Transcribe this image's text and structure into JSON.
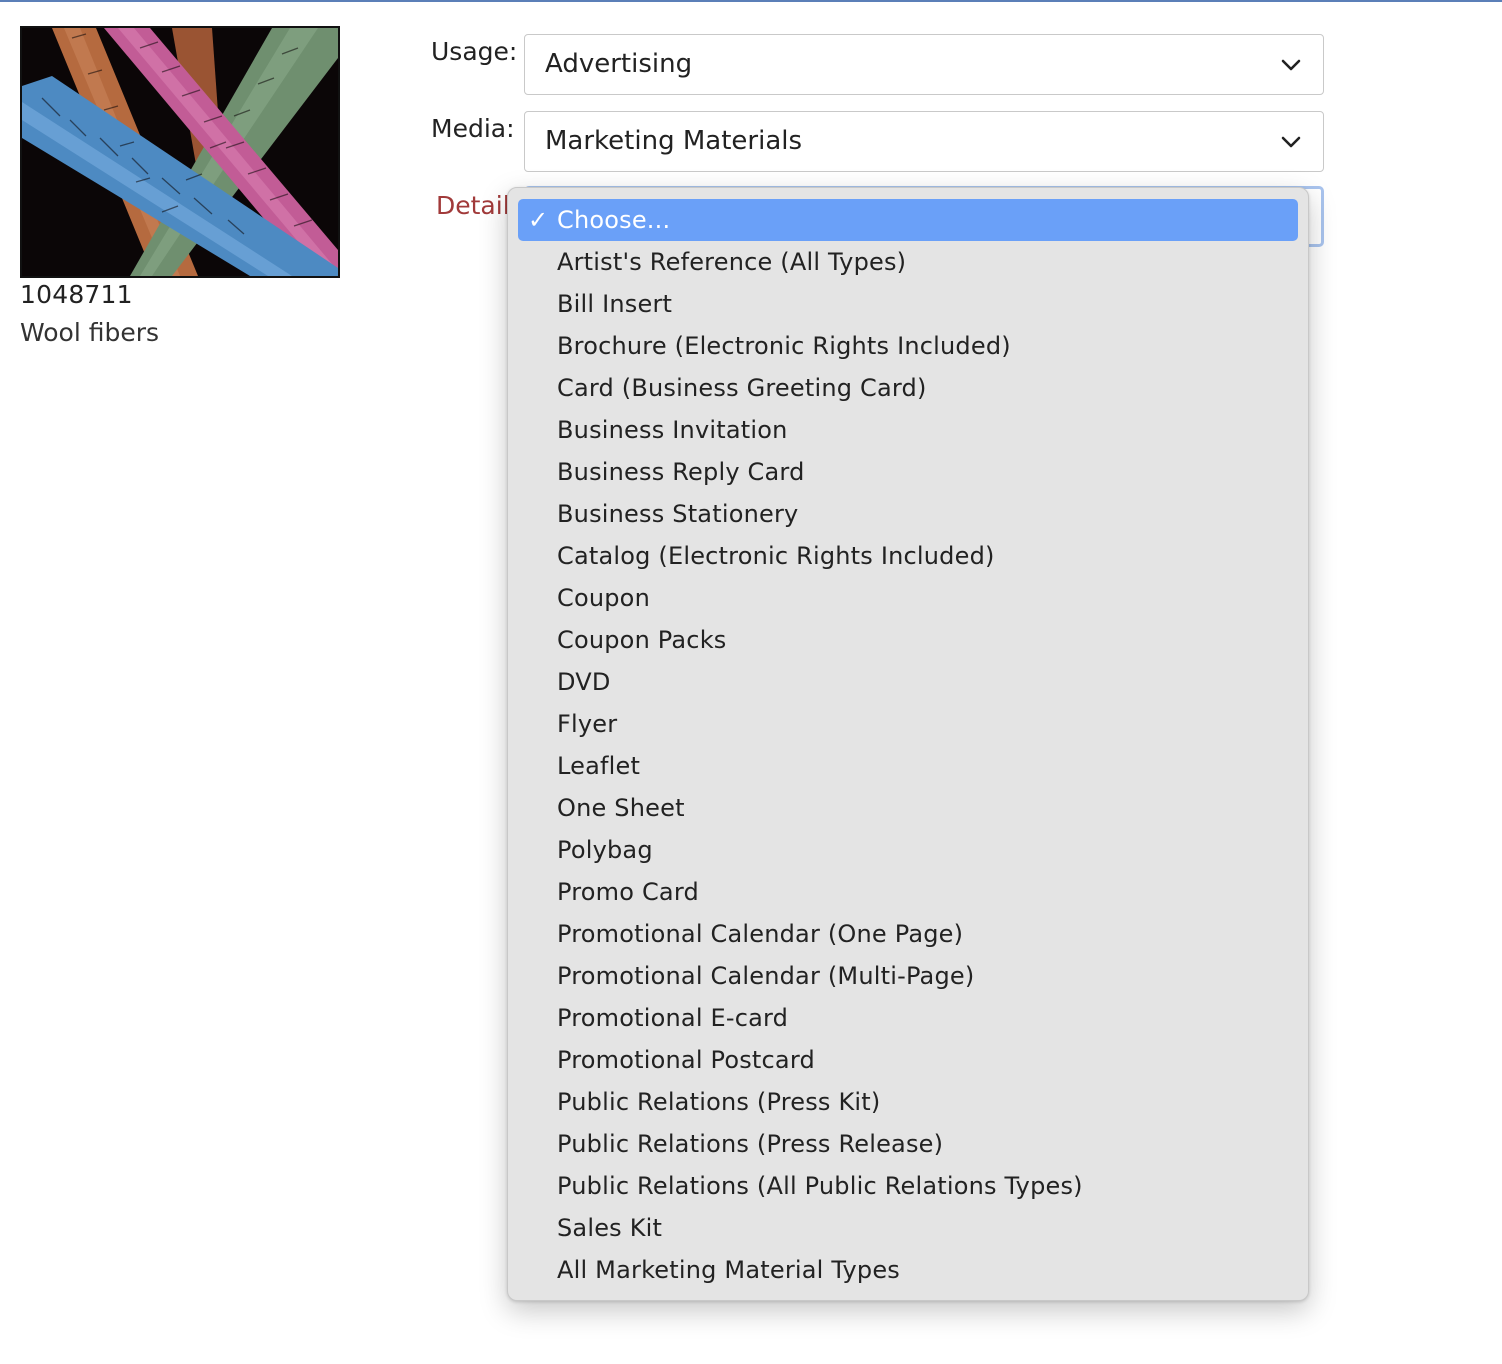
{
  "image": {
    "id": "1048711",
    "caption": "Wool fibers"
  },
  "form": {
    "usage": {
      "label": "Usage:",
      "value": "Advertising"
    },
    "media": {
      "label": "Media:",
      "value": "Marketing Materials"
    },
    "detail": {
      "label": "Detail:"
    }
  },
  "dropdown": {
    "selected_mark": "✓",
    "options": [
      "Choose...",
      "Artist's Reference (All Types)",
      "Bill Insert",
      "Brochure (Electronic Rights Included)",
      "Card (Business Greeting Card)",
      "Business Invitation",
      "Business Reply Card",
      "Business Stationery",
      "Catalog (Electronic Rights Included)",
      "Coupon",
      "Coupon Packs",
      "DVD",
      "Flyer",
      "Leaflet",
      "One Sheet",
      "Polybag",
      "Promo Card",
      "Promotional Calendar (One Page)",
      "Promotional Calendar (Multi-Page)",
      "Promotional E-card",
      "Promotional Postcard",
      "Public Relations (Press Kit)",
      "Public Relations (Press Release)",
      "Public Relations (All Public Relations Types)",
      "Sales Kit",
      "All Marketing Material Types"
    ]
  },
  "colors": {
    "top_rule": "#5b7fb8",
    "menu_bg": "#e4e4e4",
    "highlight": "#6aa0f8",
    "detail_label": "#a13a3a",
    "focus_ring": "#a9c4ee"
  },
  "icons": {
    "select_arrow": "chevron-down-icon",
    "selected_mark": "checkmark-icon"
  }
}
